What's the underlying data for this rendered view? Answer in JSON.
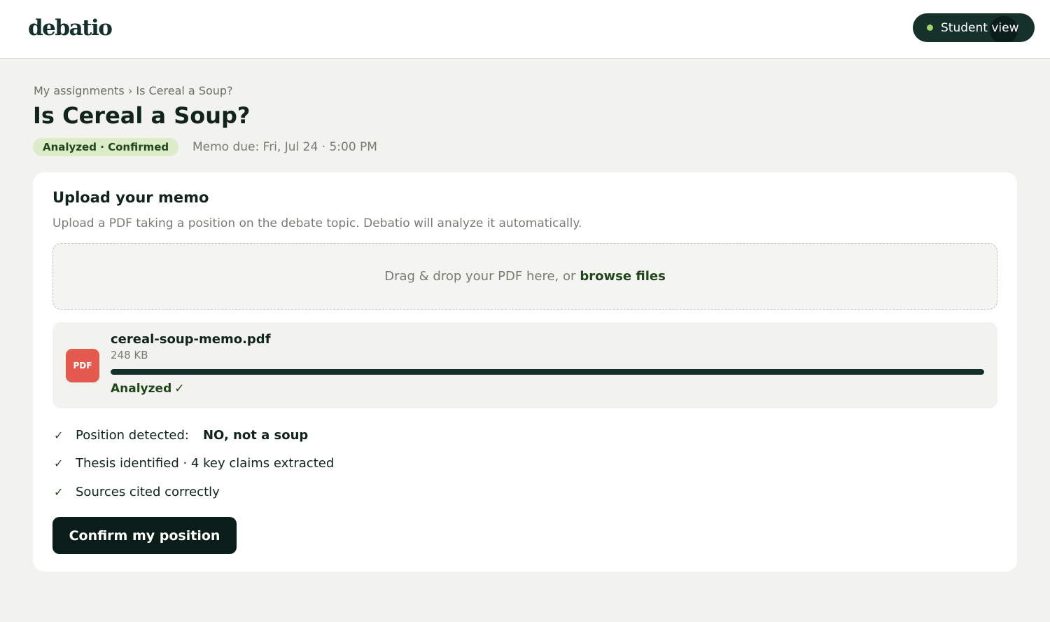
{
  "app": {
    "logo_text": "debatio",
    "student_view_label": "Student view",
    "status_dot_color": "#9ed36a"
  },
  "breadcrumb": {
    "parent": "My assignments",
    "separator": "›",
    "current": "Is Cereal a Soup?"
  },
  "assignment": {
    "title": "Is Cereal a Soup?",
    "status_badge": "Analyzed · Confirmed",
    "due_text": "Memo due: Fri, Jul 24 · 5:00 PM"
  },
  "upload": {
    "title": "Upload your memo",
    "description": "Upload a PDF taking a position on the debate topic. Debatio will analyze it automatically.",
    "dropzone_text": "Drag & drop your PDF here, or",
    "browse_label": "browse files"
  },
  "file": {
    "icon_label": "PDF",
    "name": "cereal-soup-memo.pdf",
    "size": "248 KB",
    "progress_percent": 100,
    "status": "Analyzed",
    "status_mark": "✓"
  },
  "checks": [
    {
      "label": "Position detected:",
      "value": "NO, not a soup"
    },
    {
      "label": "Thesis identified · 4 key claims extracted"
    },
    {
      "label": "Sources cited correctly"
    }
  ],
  "actions": {
    "confirm_label": "Confirm my position"
  },
  "colors": {
    "brand_dark": "#13302a",
    "accent_green": "#22461c",
    "badge_bg": "#dcebc8",
    "pdf_red": "#e55a4f"
  }
}
